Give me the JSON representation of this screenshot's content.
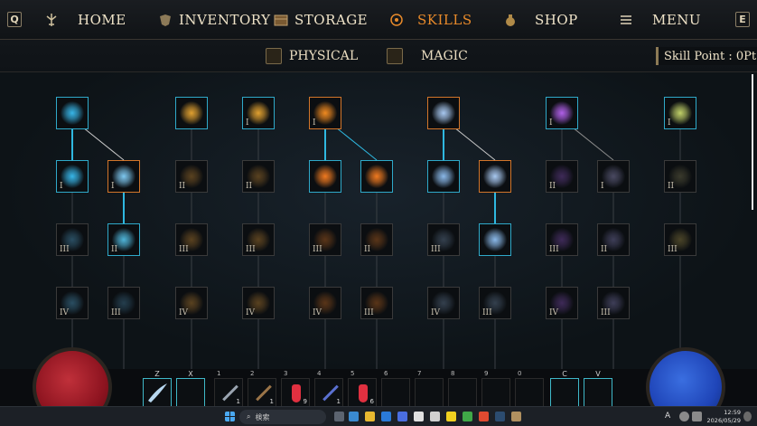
{
  "nav": {
    "left_key": "Q",
    "right_key": "E",
    "home": "HOME",
    "inventory": "INVENTORY",
    "storage": "STORAGE",
    "skills": "SKILLS",
    "shop": "SHOP",
    "menu": "MENU",
    "active_color": "#e88a2a"
  },
  "tabs": {
    "physical": "PHYSICAL",
    "magic": "MAGIC"
  },
  "skill_point": "Skill Point : 0Pt",
  "tree": {
    "tiers": [
      "I",
      "II",
      "III",
      "IV"
    ],
    "nodes": [
      {
        "col": 0,
        "row": 0,
        "tier": "",
        "color": "#38b6e8",
        "selected": "blue"
      },
      {
        "col": 0,
        "row": 1,
        "tier": "I",
        "color": "#38b6e8",
        "selected": "blue"
      },
      {
        "col": 1,
        "row": 1,
        "tier": "I",
        "color": "#7ec8f0",
        "selected": "orange"
      },
      {
        "col": 0,
        "row": 2,
        "tier": "III",
        "color": "#2a4e62",
        "selected": ""
      },
      {
        "col": 1,
        "row": 2,
        "tier": "II",
        "color": "#4fb4d8",
        "selected": "blue"
      },
      {
        "col": 0,
        "row": 3,
        "tier": "IV",
        "color": "#2a4e62",
        "selected": ""
      },
      {
        "col": 1,
        "row": 3,
        "tier": "III",
        "color": "#243e4e",
        "selected": ""
      },
      {
        "col": 2,
        "row": 0,
        "tier": "",
        "color": "#e0a030",
        "selected": "blue"
      },
      {
        "col": 2,
        "row": 1,
        "tier": "II",
        "color": "#5a4220",
        "selected": ""
      },
      {
        "col": 2,
        "row": 2,
        "tier": "III",
        "color": "#5a4220",
        "selected": ""
      },
      {
        "col": 2,
        "row": 3,
        "tier": "IV",
        "color": "#5a4220",
        "selected": ""
      },
      {
        "col": 3,
        "row": 0,
        "tier": "I",
        "color": "#e0a030",
        "selected": "blue"
      },
      {
        "col": 3,
        "row": 1,
        "tier": "II",
        "color": "#5a4220",
        "selected": ""
      },
      {
        "col": 3,
        "row": 2,
        "tier": "III",
        "color": "#5a4220",
        "selected": ""
      },
      {
        "col": 3,
        "row": 3,
        "tier": "IV",
        "color": "#5a4220",
        "selected": ""
      },
      {
        "col": 4,
        "row": 0,
        "tier": "I",
        "color": "#f08a20",
        "selected": "orange"
      },
      {
        "col": 4,
        "row": 1,
        "tier": "",
        "color": "#f07a20",
        "selected": "blue"
      },
      {
        "col": 5,
        "row": 1,
        "tier": "",
        "color": "#f07a20",
        "selected": "blue"
      },
      {
        "col": 4,
        "row": 2,
        "tier": "III",
        "color": "#5a3518",
        "selected": ""
      },
      {
        "col": 5,
        "row": 2,
        "tier": "II",
        "color": "#5a3518",
        "selected": ""
      },
      {
        "col": 4,
        "row": 3,
        "tier": "IV",
        "color": "#5a3518",
        "selected": ""
      },
      {
        "col": 5,
        "row": 3,
        "tier": "III",
        "color": "#5a3518",
        "selected": ""
      },
      {
        "col": 6,
        "row": 0,
        "tier": "",
        "color": "#a8c8f0",
        "selected": "orange"
      },
      {
        "col": 6,
        "row": 1,
        "tier": "",
        "color": "#8ab8e8",
        "selected": "blue"
      },
      {
        "col": 7,
        "row": 1,
        "tier": "",
        "color": "#a8c8f0",
        "selected": "orange"
      },
      {
        "col": 6,
        "row": 2,
        "tier": "III",
        "color": "#34404e",
        "selected": ""
      },
      {
        "col": 7,
        "row": 2,
        "tier": "",
        "color": "#8ab8e8",
        "selected": "blue"
      },
      {
        "col": 6,
        "row": 3,
        "tier": "IV",
        "color": "#34404e",
        "selected": ""
      },
      {
        "col": 7,
        "row": 3,
        "tier": "III",
        "color": "#34404e",
        "selected": ""
      },
      {
        "col": 8,
        "row": 0,
        "tier": "I",
        "color": "#b060e8",
        "selected": "blue"
      },
      {
        "col": 8,
        "row": 1,
        "tier": "II",
        "color": "#3e2a58",
        "selected": ""
      },
      {
        "col": 9,
        "row": 1,
        "tier": "I",
        "color": "#4a4a62",
        "selected": ""
      },
      {
        "col": 8,
        "row": 2,
        "tier": "III",
        "color": "#3e2a58",
        "selected": ""
      },
      {
        "col": 9,
        "row": 2,
        "tier": "II",
        "color": "#3e3e58",
        "selected": ""
      },
      {
        "col": 8,
        "row": 3,
        "tier": "IV",
        "color": "#3e2a58",
        "selected": ""
      },
      {
        "col": 9,
        "row": 3,
        "tier": "III",
        "color": "#3e3e58",
        "selected": ""
      },
      {
        "col": 10,
        "row": 0,
        "tier": "I",
        "color": "#c0d068",
        "selected": "blue"
      },
      {
        "col": 10,
        "row": 1,
        "tier": "II",
        "color": "#3a3a2c",
        "selected": ""
      },
      {
        "col": 10,
        "row": 2,
        "tier": "III",
        "color": "#4a4428",
        "selected": ""
      }
    ]
  },
  "hotbar": {
    "z": "Z",
    "x": "X",
    "c": "C",
    "v": "V",
    "slots": [
      {
        "num": "1",
        "qty": "1",
        "item": "sword"
      },
      {
        "num": "2",
        "qty": "1",
        "item": "bow"
      },
      {
        "num": "3",
        "qty": "9",
        "item": "red-potion"
      },
      {
        "num": "4",
        "qty": "1",
        "item": "staff"
      },
      {
        "num": "5",
        "qty": "6",
        "item": "red-potion"
      },
      {
        "num": "6",
        "qty": "",
        "item": ""
      },
      {
        "num": "7",
        "qty": "",
        "item": ""
      },
      {
        "num": "8",
        "qty": "",
        "item": ""
      },
      {
        "num": "9",
        "qty": "",
        "item": ""
      },
      {
        "num": "0",
        "qty": "",
        "item": ""
      }
    ]
  },
  "taskbar": {
    "search_placeholder": "検索",
    "input_indicator": "A",
    "time": "12:59",
    "date": "2026/05/29"
  }
}
